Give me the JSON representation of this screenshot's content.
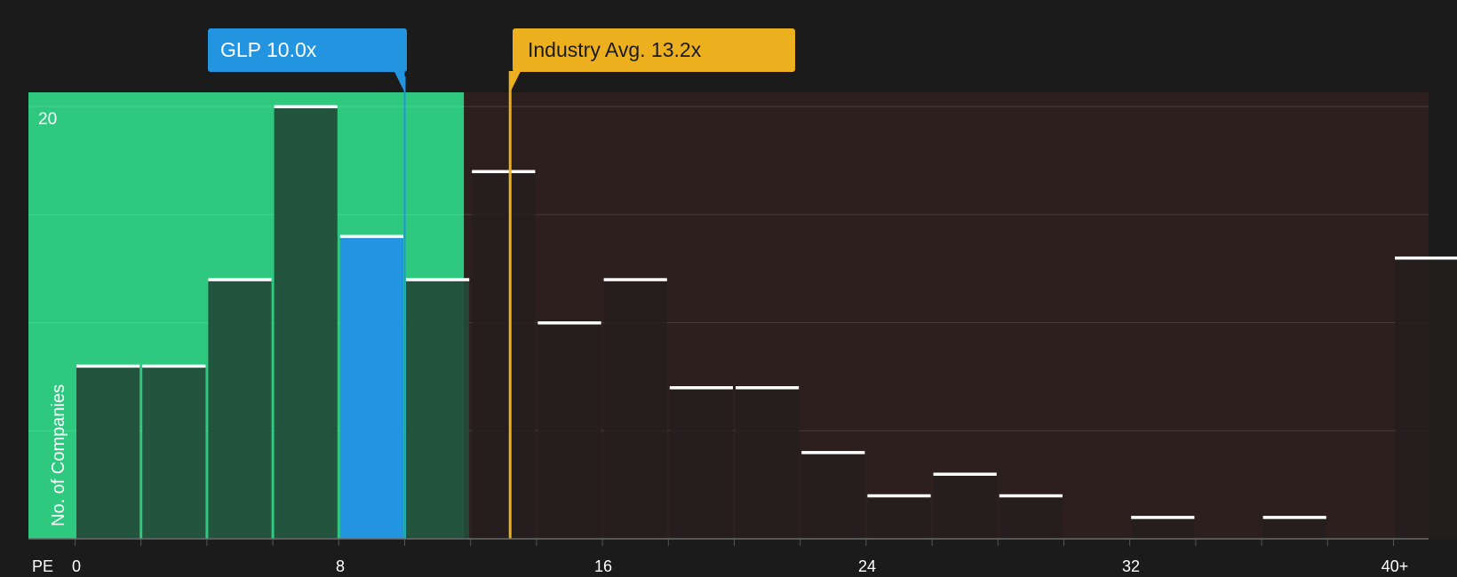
{
  "callouts": {
    "company": "GLP 10.0x",
    "industry": "Industry Avg. 13.2x"
  },
  "axis": {
    "x_title": "PE",
    "y_title": "No. of Companies",
    "y_tick": "20",
    "x_ticks": [
      "0",
      "8",
      "16",
      "24",
      "32",
      "40+"
    ]
  },
  "colors": {
    "background": "#1b1b1b",
    "undervalued_region": "#2ec97f",
    "overvalued_region": "#2e1f1f",
    "company": "#2394e0",
    "industry": "#ecb01f",
    "bar_dark": "#234a38",
    "bar_right": "#251f1f",
    "cap": "#ffffff"
  },
  "chart_data": {
    "type": "bar",
    "title": "",
    "xlabel": "PE",
    "ylabel": "No. of Companies",
    "x_ticks": [
      0,
      8,
      16,
      24,
      32,
      "40+"
    ],
    "ylim": [
      0,
      20
    ],
    "y_ticks_shown": [
      20
    ],
    "grid": true,
    "bin_width": 2,
    "bins": [
      {
        "range": [
          0,
          2
        ],
        "value": 8
      },
      {
        "range": [
          2,
          4
        ],
        "value": 8
      },
      {
        "range": [
          4,
          6
        ],
        "value": 12
      },
      {
        "range": [
          6,
          8
        ],
        "value": 20
      },
      {
        "range": [
          8,
          10
        ],
        "value": 14,
        "highlight": true
      },
      {
        "range": [
          10,
          12
        ],
        "value": 12
      },
      {
        "range": [
          12,
          14
        ],
        "value": 17
      },
      {
        "range": [
          14,
          16
        ],
        "value": 10
      },
      {
        "range": [
          16,
          18
        ],
        "value": 12
      },
      {
        "range": [
          18,
          20
        ],
        "value": 7
      },
      {
        "range": [
          20,
          22
        ],
        "value": 7
      },
      {
        "range": [
          22,
          24
        ],
        "value": 4
      },
      {
        "range": [
          24,
          26
        ],
        "value": 2
      },
      {
        "range": [
          26,
          28
        ],
        "value": 3
      },
      {
        "range": [
          28,
          30
        ],
        "value": 2
      },
      {
        "range": [
          30,
          32
        ],
        "value": 0
      },
      {
        "range": [
          32,
          34
        ],
        "value": 1
      },
      {
        "range": [
          34,
          36
        ],
        "value": 0
      },
      {
        "range": [
          36,
          38
        ],
        "value": 1
      },
      {
        "range": [
          38,
          40
        ],
        "value": 0
      },
      {
        "range": [
          40,
          42
        ],
        "value": 13
      }
    ],
    "company": {
      "name": "GLP",
      "pe": 10.0
    },
    "industry_avg": 13.2,
    "undervalued_threshold": 11.8
  }
}
